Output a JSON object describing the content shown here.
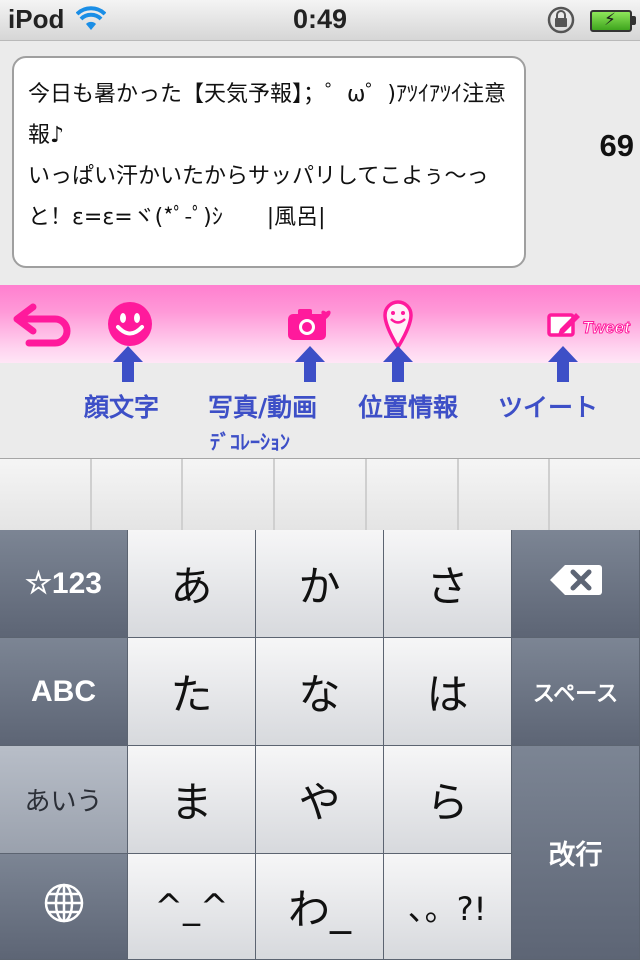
{
  "status_bar": {
    "carrier": "iPod",
    "time": "0:49",
    "battery_color": "#4fc72b"
  },
  "compose": {
    "text": "今日も暑かった【天気予報】；゜ω゜)ｱﾂｲｱﾂｲ注意報♪\nいっぱい汗かいたからサッパリしてこよぅ〜っと！ε=ε=ヾ(*ﾟ-ﾟ)ｼ　　|風呂|",
    "remaining_count": "69"
  },
  "toolbar": {
    "accent": "#ff2aa8",
    "icons": [
      "undo-icon",
      "smiley-icon",
      "camera-icon",
      "location-pin-icon",
      "tweet-edit-icon"
    ],
    "tweet_label": "Tweet"
  },
  "hints": {
    "emoticon": "顔文字",
    "photo_video": "写真/動画",
    "decoration": "ﾃﾞｺﾚｰｼｮﾝ",
    "location": "位置情報",
    "tweet": "ツイート",
    "color": "#3d4fc7"
  },
  "keyboard": {
    "row1": [
      "☆123",
      "あ",
      "か",
      "さ"
    ],
    "row2": [
      "ABC",
      "た",
      "な",
      "は",
      "スペース"
    ],
    "row3": [
      "あいう",
      "ま",
      "や",
      "ら"
    ],
    "row4": [
      "^_^",
      "わ_",
      "､。?!"
    ],
    "return_label": "改行",
    "icons": [
      "delete-icon",
      "globe-icon"
    ]
  }
}
